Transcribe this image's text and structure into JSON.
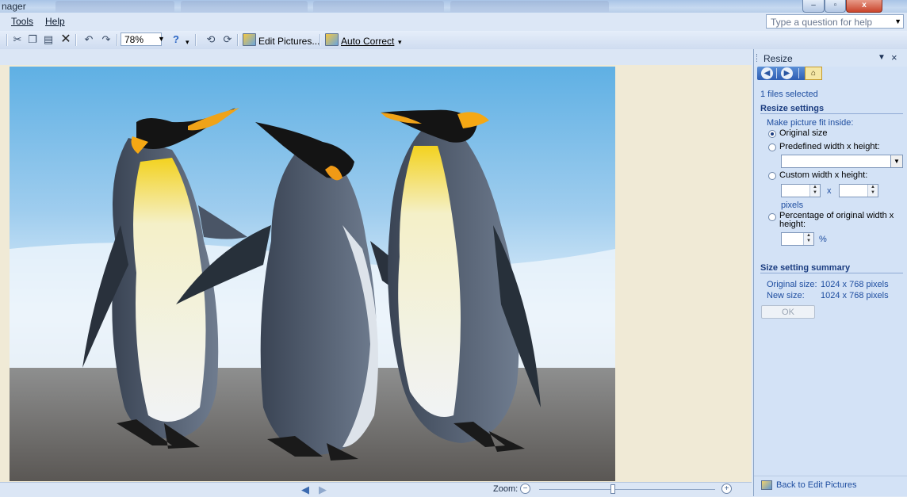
{
  "window": {
    "title": "nager",
    "controls": {
      "minimize": "–",
      "maximize": "▫",
      "close": "x"
    }
  },
  "menubar": {
    "items": [
      {
        "label": "Tools",
        "access_key": "T"
      },
      {
        "label": "Help",
        "access_key": "H"
      }
    ],
    "help_placeholder": "Type a question for help"
  },
  "toolbar": {
    "zoom_value": "78%",
    "edit_pictures_label": "Edit Pictures...",
    "auto_correct_label": "Auto Correct",
    "icons": [
      "cut-icon",
      "copy-icon",
      "paste-icon",
      "delete-icon",
      "undo-icon",
      "redo-icon",
      "help-icon",
      "rotate-left-icon",
      "rotate-right-icon"
    ]
  },
  "statusbar": {
    "zoom_label": "Zoom:",
    "zoom_level": 0.42
  },
  "taskpane": {
    "title": "Resize",
    "files_selected": "1 files selected",
    "resize_settings_heading": "Resize settings",
    "fit_inside_label": "Make picture fit inside:",
    "options": {
      "original": "Original size",
      "predefined": "Predefined width x height:",
      "custom": "Custom width x height:",
      "percentage": "Percentage of original width x height:"
    },
    "selected_option": "original",
    "predefined_value": "",
    "custom_width": "",
    "custom_height": "",
    "custom_x": "x",
    "pixels_label": "pixels",
    "percentage_value": "",
    "percent_sign": "%",
    "summary_heading": "Size setting summary",
    "original_size_label": "Original size:",
    "original_size_value": "1024 x 768 pixels",
    "new_size_label": "New size:",
    "new_size_value": "1024 x 768 pixels",
    "ok_label": "OK",
    "back_link": "Back to Edit Pictures"
  },
  "colors": {
    "accent": "#1f4ea0",
    "pane_bg": "#d3e2f6",
    "work_bg": "#f0ead6"
  }
}
